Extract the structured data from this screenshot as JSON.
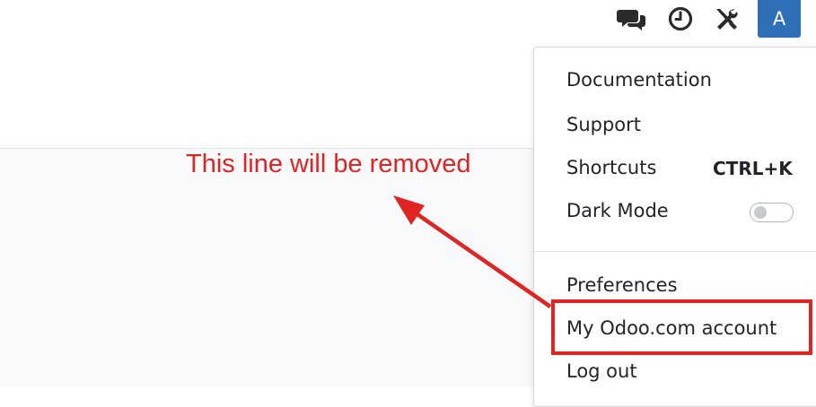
{
  "systray": {
    "icons": [
      "chat-icon",
      "activity-clock-icon",
      "debug-tools-icon"
    ],
    "avatar_initial": "A"
  },
  "user_menu": {
    "items": [
      {
        "label": "Documentation"
      },
      {
        "label": "Support"
      },
      {
        "label": "Shortcuts",
        "shortcut": "CTRL+K"
      },
      {
        "label": "Dark Mode",
        "toggle_on": false
      },
      {
        "label": "Preferences"
      },
      {
        "label": "My Odoo.com account"
      },
      {
        "label": "Log out"
      }
    ]
  },
  "annotation": {
    "text": "This line will be removed",
    "color": "#e02424"
  },
  "colors": {
    "avatar_bg": "#2f6fb7",
    "highlight": "#e32222"
  }
}
